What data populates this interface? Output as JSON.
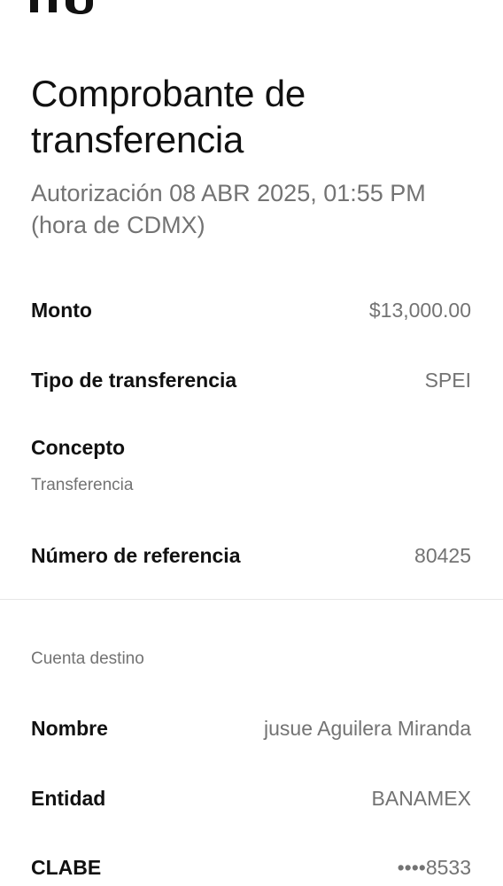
{
  "header": {
    "title": "Comprobante de transferencia",
    "subtitle": "Autorización 08 ABR 2025, 01:55 PM (hora de CDMX)"
  },
  "details": {
    "monto": {
      "label": "Monto",
      "value": "$13,000.00"
    },
    "tipo": {
      "label": "Tipo de transferencia",
      "value": "SPEI"
    },
    "concepto": {
      "label": "Concepto",
      "value": "Transferencia"
    },
    "referencia": {
      "label": "Número de referencia",
      "value": "80425"
    }
  },
  "destination": {
    "section_label": "Cuenta destino",
    "nombre": {
      "label": "Nombre",
      "value": "jusue Aguilera Miranda"
    },
    "entidad": {
      "label": "Entidad",
      "value": "BANAMEX"
    },
    "clabe": {
      "label": "CLABE",
      "value": "••••8533"
    }
  },
  "theme": {
    "background": "#ffffff",
    "primary_text": "#111111",
    "secondary_text": "#737373",
    "divider": "#e6e6e6"
  },
  "icons": {
    "logo": "nu-logo-partial"
  }
}
